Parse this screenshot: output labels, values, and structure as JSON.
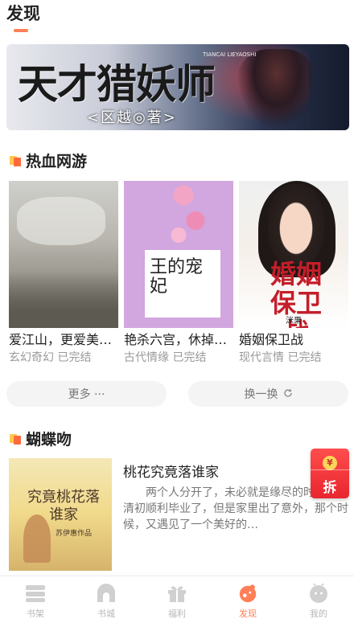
{
  "header": {
    "title": "发现"
  },
  "banner": {
    "title": "天才猎妖师",
    "author": "<区越◎著>",
    "english": "TIANCAI LIEYAOSHI"
  },
  "section1": {
    "title": "热血网游",
    "books": [
      {
        "title": "爱江山，更爱美…",
        "meta": "玄幻奇幻 已完结"
      },
      {
        "title": "艳杀六宫，休掉…",
        "meta": "古代情缘 已完结",
        "cover_text": "王的宠妃"
      },
      {
        "title": "婚姻保卫战",
        "meta": "现代言情 已完结",
        "cover_text": "婚姻保卫战",
        "cover_author": "洣果"
      }
    ],
    "more_label": "更多 ···",
    "refresh_label": "换一换"
  },
  "section2": {
    "title": "蝴蝶吻",
    "feature": {
      "title": "桃花究竟落谁家",
      "desc": "两个人分开了，未必就是缘尽的时候。刘清初顺利毕业了，但是家里出了意外，那个时候，又遇见了一个美好的…",
      "cover_text": "究竟桃花落谁家",
      "cover_author": "苏伊惠作品"
    }
  },
  "redpacket": {
    "label": "拆",
    "coin": "¥"
  },
  "tabbar": {
    "tabs": [
      {
        "label": "书架",
        "icon": "bookshelf-icon"
      },
      {
        "label": "书城",
        "icon": "bookstore-icon"
      },
      {
        "label": "福利",
        "icon": "gift-icon"
      },
      {
        "label": "发现",
        "icon": "discover-icon",
        "active": true
      },
      {
        "label": "我的",
        "icon": "profile-icon"
      }
    ]
  },
  "colors": {
    "accent": "#ff7f57",
    "tab_inactive": "#b7b7b7",
    "redpacket": "#e8262e"
  }
}
